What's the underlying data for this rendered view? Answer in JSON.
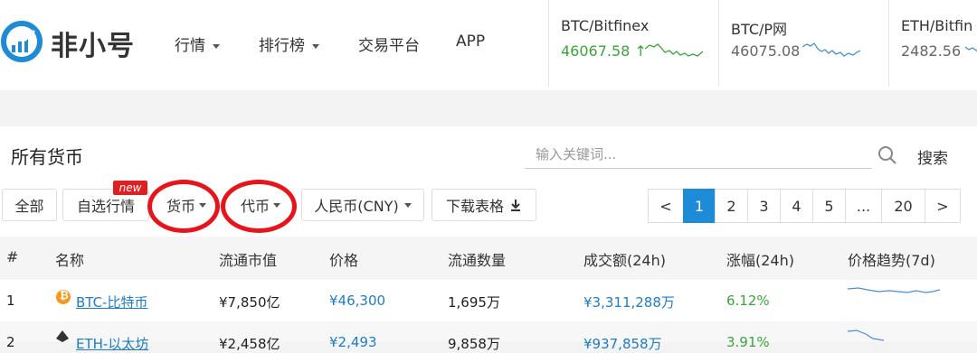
{
  "header": {
    "brand": "非小号",
    "nav": [
      {
        "label": "行情",
        "dropdown": true
      },
      {
        "label": "排行榜",
        "dropdown": true
      },
      {
        "label": "交易平台",
        "dropdown": false
      },
      {
        "label": "APP",
        "dropdown": false
      }
    ]
  },
  "tickers": [
    {
      "name": "BTC/Bitfinex",
      "price": "46067.58",
      "arrow": "↑",
      "trend": "up"
    },
    {
      "name": "BTC/P网",
      "price": "46075.08",
      "trend": "flat"
    },
    {
      "name": "ETH/Bitfin",
      "price": "2482.56",
      "trend": "flat"
    }
  ],
  "panel": {
    "title": "所有货币",
    "search_placeholder": "输入关键词...",
    "search_label": "搜索"
  },
  "filters": {
    "all": "全部",
    "watchlist": "自选行情",
    "new_badge": "new",
    "currency": "货币",
    "token": "代币",
    "fiat": "人民币(CNY)",
    "download": "下载表格"
  },
  "pagination": {
    "prev": "<",
    "pages": [
      "1",
      "2",
      "3",
      "4",
      "5",
      "...",
      "20"
    ],
    "next": ">",
    "current": "1"
  },
  "table": {
    "headers": [
      "#",
      "名称",
      "流通市值",
      "价格",
      "流通数量",
      "成交额(24h)",
      "涨幅(24h)",
      "价格趋势(7d)"
    ],
    "rows": [
      {
        "rank": "1",
        "name": "BTC-比特币",
        "market_cap": "¥7,850亿",
        "price": "¥46,300",
        "supply": "1,695万",
        "volume": "¥3,311,288万",
        "change": "6.12%"
      },
      {
        "rank": "2",
        "name": "ETH-以太坊",
        "market_cap": "¥2,458亿",
        "price": "¥2,493",
        "supply": "9,858万",
        "volume": "¥937,858万",
        "change": "3.91%"
      }
    ]
  },
  "colors": {
    "accent": "#1e8bd6",
    "up": "#3aa53a",
    "highlight_ring": "#e8141c",
    "badge": "#e02020",
    "link": "#1e7cc4"
  }
}
